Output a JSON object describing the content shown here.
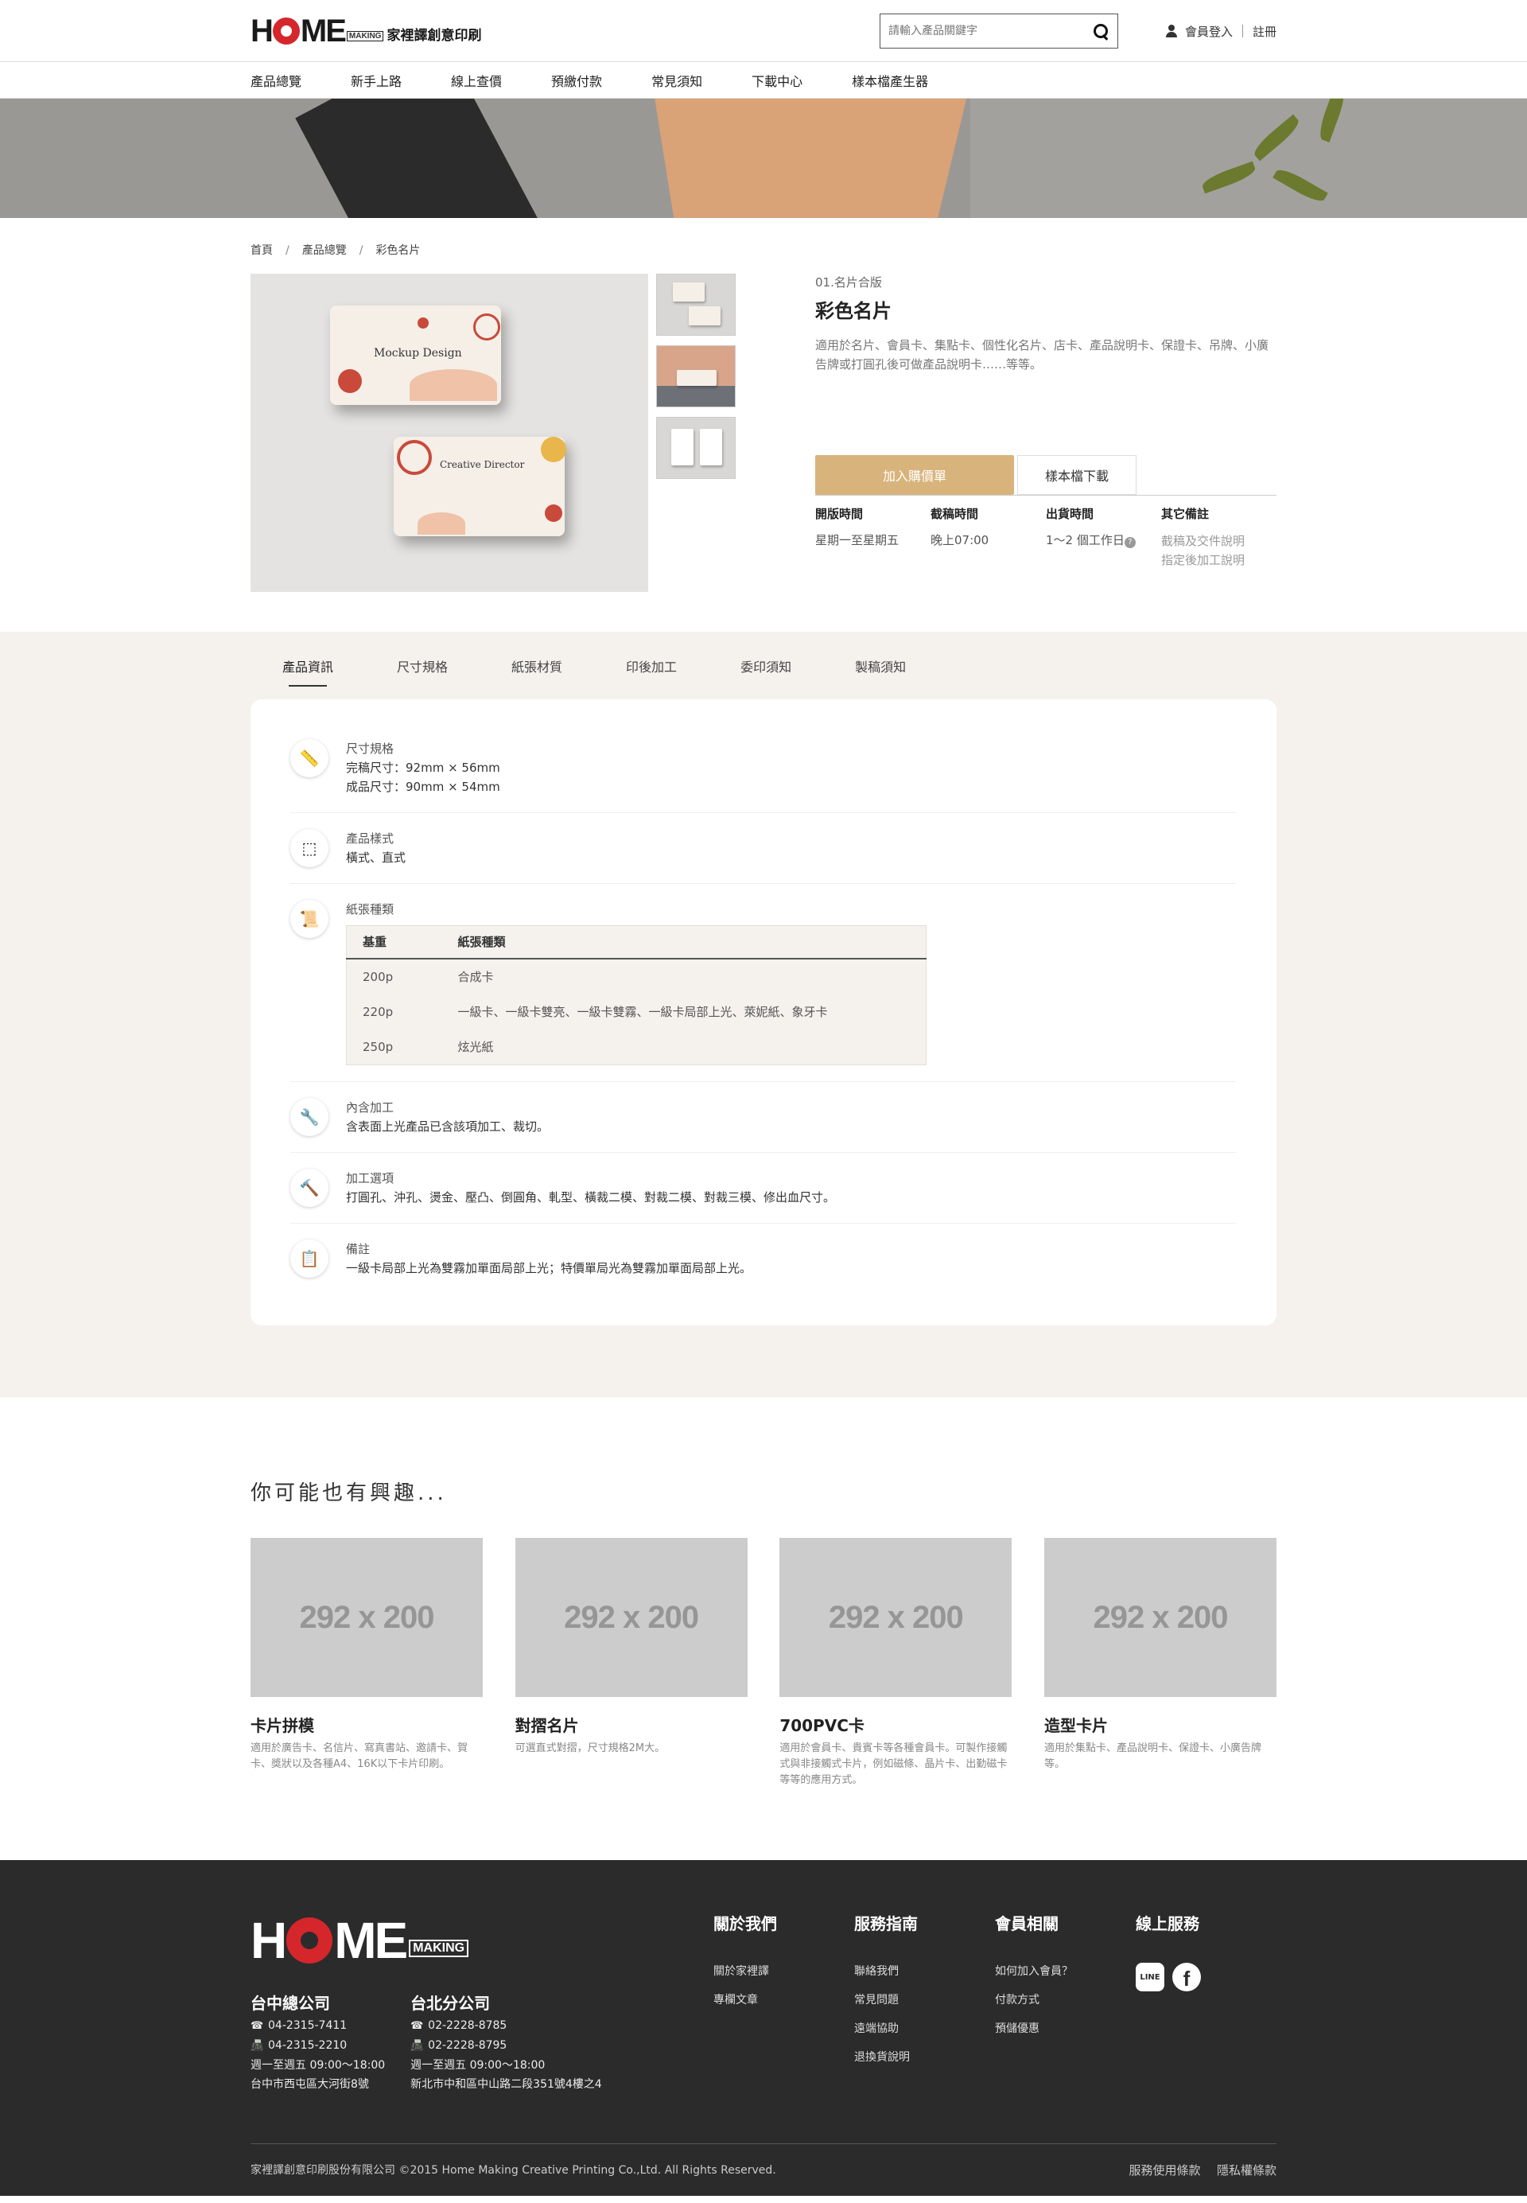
{
  "header": {
    "logo_home": "HOME",
    "logo_making": "MAKING",
    "logo_cn": "家裡譯創意印刷",
    "search_placeholder": "請輸入產品關鍵字",
    "login": "會員登入",
    "register": "註冊"
  },
  "nav": [
    "產品總覽",
    "新手上路",
    "線上查價",
    "預繳付款",
    "常見須知",
    "下載中心",
    "樣本檔產生器"
  ],
  "breadcrumb": [
    "首頁",
    "產品總覽",
    "彩色名片"
  ],
  "product": {
    "image_card1_text": "Mockup Design",
    "image_card2_text": "Creative Director",
    "category": "01.名片合版",
    "title": "彩色名片",
    "description": "適用於名片、會員卡、集點卡、個性化名片、店卡、產品說明卡、保證卡、吊牌、小廣告牌或打圓孔後可做產品說明卡……等等。",
    "add_cart": "加入購價單",
    "download_sample": "樣本檔下載",
    "specs": [
      {
        "label": "開版時間",
        "value": "星期一至星期五"
      },
      {
        "label": "截稿時間",
        "value": "晚上07:00"
      },
      {
        "label": "出貨時間",
        "value": "1～2 個工作日"
      },
      {
        "label": "其它備註",
        "notes": [
          "截稿及交件說明",
          "指定後加工說明"
        ]
      }
    ]
  },
  "tabs": [
    "產品資訊",
    "尺寸規格",
    "紙張材質",
    "印後加工",
    "委印須知",
    "製稿須知"
  ],
  "info_rows": {
    "size": {
      "title": "尺寸規格",
      "lines": [
        "完稿尺寸：92mm × 56mm",
        "成品尺寸：90mm × 54mm"
      ]
    },
    "style": {
      "title": "產品樣式",
      "lines": [
        "橫式、直式"
      ]
    },
    "paper": {
      "title": "紙張種類",
      "headers": [
        "基重",
        "紙張種類"
      ],
      "rows": [
        [
          "200p",
          "合成卡"
        ],
        [
          "220p",
          "一級卡、一級卡雙亮、一級卡雙霧、一級卡局部上光、萊妮紙、象牙卡"
        ],
        [
          "250p",
          "炫光紙"
        ]
      ]
    },
    "included": {
      "title": "內含加工",
      "lines": [
        "含表面上光產品已含該項加工、裁切。"
      ]
    },
    "options": {
      "title": "加工選項",
      "lines": [
        "打圓孔、沖孔、燙金、壓凸、倒圓角、軋型、橫裁二模、對裁二模、對裁三模、修出血尺寸。"
      ]
    },
    "note": {
      "title": "備註",
      "lines": [
        "一級卡局部上光為雙霧加單面局部上光；特價單局光為雙霧加單面局部上光。"
      ]
    }
  },
  "recommend": {
    "heading": "你可能也有興趣...",
    "items": [
      {
        "placeholder": "292 x 200",
        "title": "卡片拼模",
        "desc": "適用於廣告卡、名信片、寫真書站、邀請卡、賀卡、獎狀以及各種A4、16K以下卡片印刷。"
      },
      {
        "placeholder": "292 x 200",
        "title": "對摺名片",
        "desc": "可選直式對摺，尺寸規格2M大。"
      },
      {
        "placeholder": "292 x 200",
        "title": "700PVC卡",
        "desc": "適用於會員卡、貴賓卡等各種會員卡。可製作接觸式與非接觸式卡片，例如磁條、晶片卡、出勤磁卡等等的應用方式。"
      },
      {
        "placeholder": "292 x 200",
        "title": "造型卡片",
        "desc": "適用於集點卡、產品說明卡、保證卡、小廣告牌等。"
      }
    ]
  },
  "footer": {
    "logo_home": "HOME",
    "logo_making": "MAKING",
    "offices": [
      {
        "name": "台中總公司",
        "tel": "04-2315-7411",
        "fax": "04-2315-2210",
        "hours": "週一至週五 09:00～18:00",
        "address": "台中市西屯區大河街8號"
      },
      {
        "name": "台北分公司",
        "tel": "02-2228-8785",
        "fax": "02-2228-8795",
        "hours": "週一至週五 09:00～18:00",
        "address": "新北市中和區中山路二段351號4樓之4"
      }
    ],
    "columns": [
      {
        "title": "關於我們",
        "links": [
          "關於家裡譯",
          "專欄文章"
        ]
      },
      {
        "title": "服務指南",
        "links": [
          "聯絡我們",
          "常見問題",
          "遠端協助",
          "退換貨說明"
        ]
      },
      {
        "title": "會員相關",
        "links": [
          "如何加入會員？",
          "付款方式",
          "預儲優惠"
        ]
      },
      {
        "title": "線上服務",
        "links": []
      }
    ],
    "line_label": "LINE",
    "fb_label": "f",
    "copyright": "家裡譯創意印刷股份有限公司 ©2015 Home Making Creative Printing Co.,Ltd. All Rights Reserved.",
    "terms": "服務使用條款",
    "privacy": "隱私權條款"
  }
}
